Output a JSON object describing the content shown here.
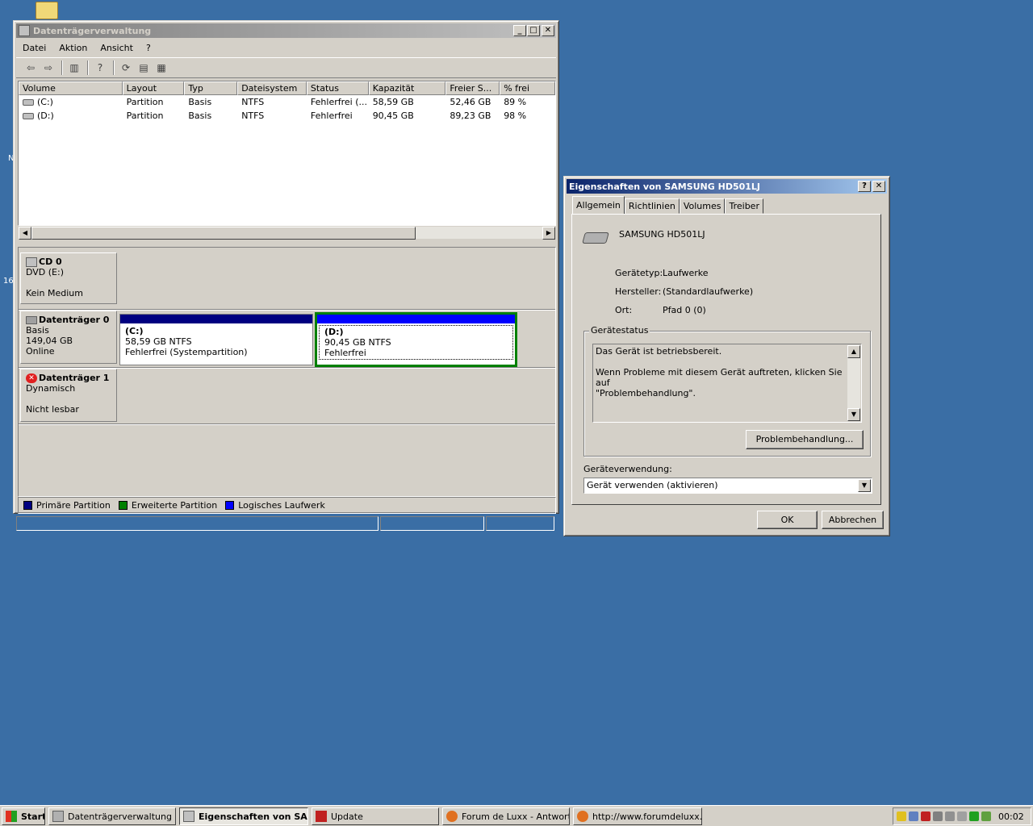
{
  "desktop": {
    "edge_text_1": "N",
    "edge_text_2": "16"
  },
  "main_window": {
    "title": "Datenträgerverwaltung",
    "menu": [
      "Datei",
      "Aktion",
      "Ansicht",
      "?"
    ],
    "columns": [
      "Volume",
      "Layout",
      "Typ",
      "Dateisystem",
      "Status",
      "Kapazität",
      "Freier S...",
      "% frei"
    ],
    "rows": [
      [
        "(C:)",
        "Partition",
        "Basis",
        "NTFS",
        "Fehlerfrei (...",
        "58,59 GB",
        "52,46 GB",
        "89 %"
      ],
      [
        "(D:)",
        "Partition",
        "Basis",
        "NTFS",
        "Fehlerfrei",
        "90,45 GB",
        "89,23 GB",
        "98 %"
      ]
    ],
    "disks": {
      "cd0": {
        "name": "CD 0",
        "line1": "DVD (E:)",
        "line2": "",
        "line3": "Kein Medium"
      },
      "disk0": {
        "name": "Datenträger 0",
        "line1": "Basis",
        "line2": "149,04 GB",
        "line3": "Online",
        "part_c": {
          "name": "(C:)",
          "size": "58,59 GB NTFS",
          "status": "Fehlerfrei (Systempartition)"
        },
        "part_d": {
          "name": "(D:)",
          "size": "90,45 GB NTFS",
          "status": "Fehlerfrei"
        }
      },
      "disk1": {
        "name": "Datenträger 1",
        "line1": "Dynamisch",
        "line2": "",
        "line3": "Nicht lesbar"
      }
    },
    "legend": [
      {
        "label": "Primäre Partition",
        "color": "#000080"
      },
      {
        "label": "Erweiterte Partition",
        "color": "#008000"
      },
      {
        "label": "Logisches Laufwerk",
        "color": "#0000ff"
      }
    ]
  },
  "dialog": {
    "title": "Eigenschaften von SAMSUNG HD501LJ",
    "tabs": [
      "Allgemein",
      "Richtlinien",
      "Volumes",
      "Treiber"
    ],
    "device_name": "SAMSUNG HD501LJ",
    "props": [
      {
        "label": "Gerätetyp:",
        "value": "Laufwerke"
      },
      {
        "label": "Hersteller:",
        "value": "(Standardlaufwerke)"
      },
      {
        "label": "Ort:",
        "value": "Pfad 0 (0)"
      }
    ],
    "status_group": "Gerätestatus",
    "status_line1": "Das Gerät ist betriebsbereit.",
    "status_line2": "Wenn Probleme mit diesem Gerät auftreten, klicken Sie auf",
    "status_line3": "\"Problembehandlung\".",
    "troubleshoot_button": "Problembehandlung...",
    "usage_label": "Geräteverwendung:",
    "usage_value": "Gerät verwenden (aktivieren)",
    "ok_button": "OK",
    "cancel_button": "Abbrechen"
  },
  "taskbar": {
    "start": "Start",
    "buttons": [
      {
        "label": "Datenträgerverwaltung"
      },
      {
        "label": "Eigenschaften von SA..."
      },
      {
        "label": "Update"
      },
      {
        "label": "Forum de Luxx - Antwort..."
      },
      {
        "label": "http://www.forumdeluxx...."
      }
    ],
    "clock": "00:02"
  }
}
